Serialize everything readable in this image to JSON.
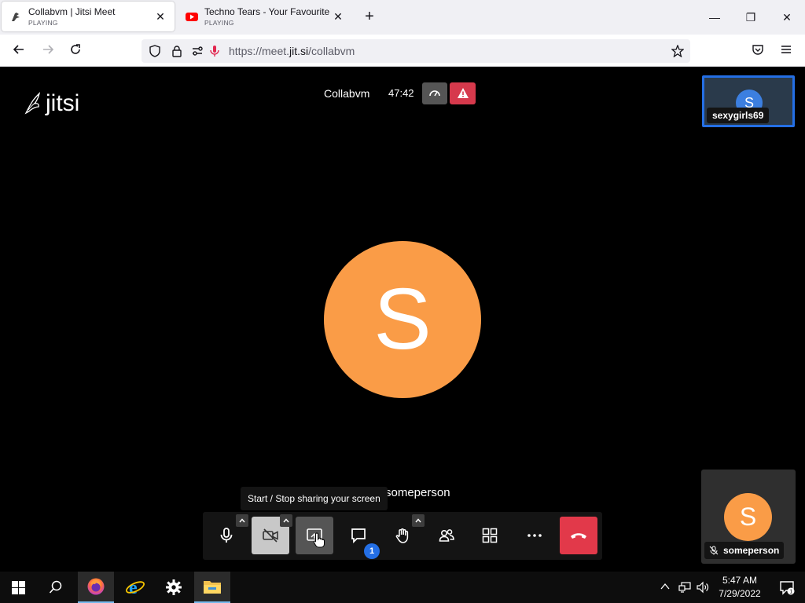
{
  "browser": {
    "tabs": [
      {
        "title": "Collabvm | Jitsi Meet",
        "status": "PLAYING"
      },
      {
        "title": "Techno Tears - Your Favourite N",
        "status": "PLAYING"
      }
    ],
    "url_prefix": "https://meet.",
    "url_domain": "jit.si",
    "url_path": "/collabvm"
  },
  "meeting": {
    "subject": "Collabvm",
    "timer": "47:42",
    "dominant_initial": "S",
    "dominant_name": "someperson",
    "tooltip": "Start / Stop sharing your screen",
    "remote": {
      "initial": "S",
      "name": "sexygirls69"
    },
    "local": {
      "initial": "S",
      "name": "someperson"
    },
    "chat_badge": "1",
    "logo_text": "jitsi"
  },
  "colors": {
    "avatar_orange": "#fa9c47",
    "avatar_blue": "#3c7fe0",
    "hangup_red": "#e2394a",
    "active_border": "#246fe5"
  },
  "taskbar": {
    "time": "5:47 AM",
    "date": "7/29/2022"
  }
}
